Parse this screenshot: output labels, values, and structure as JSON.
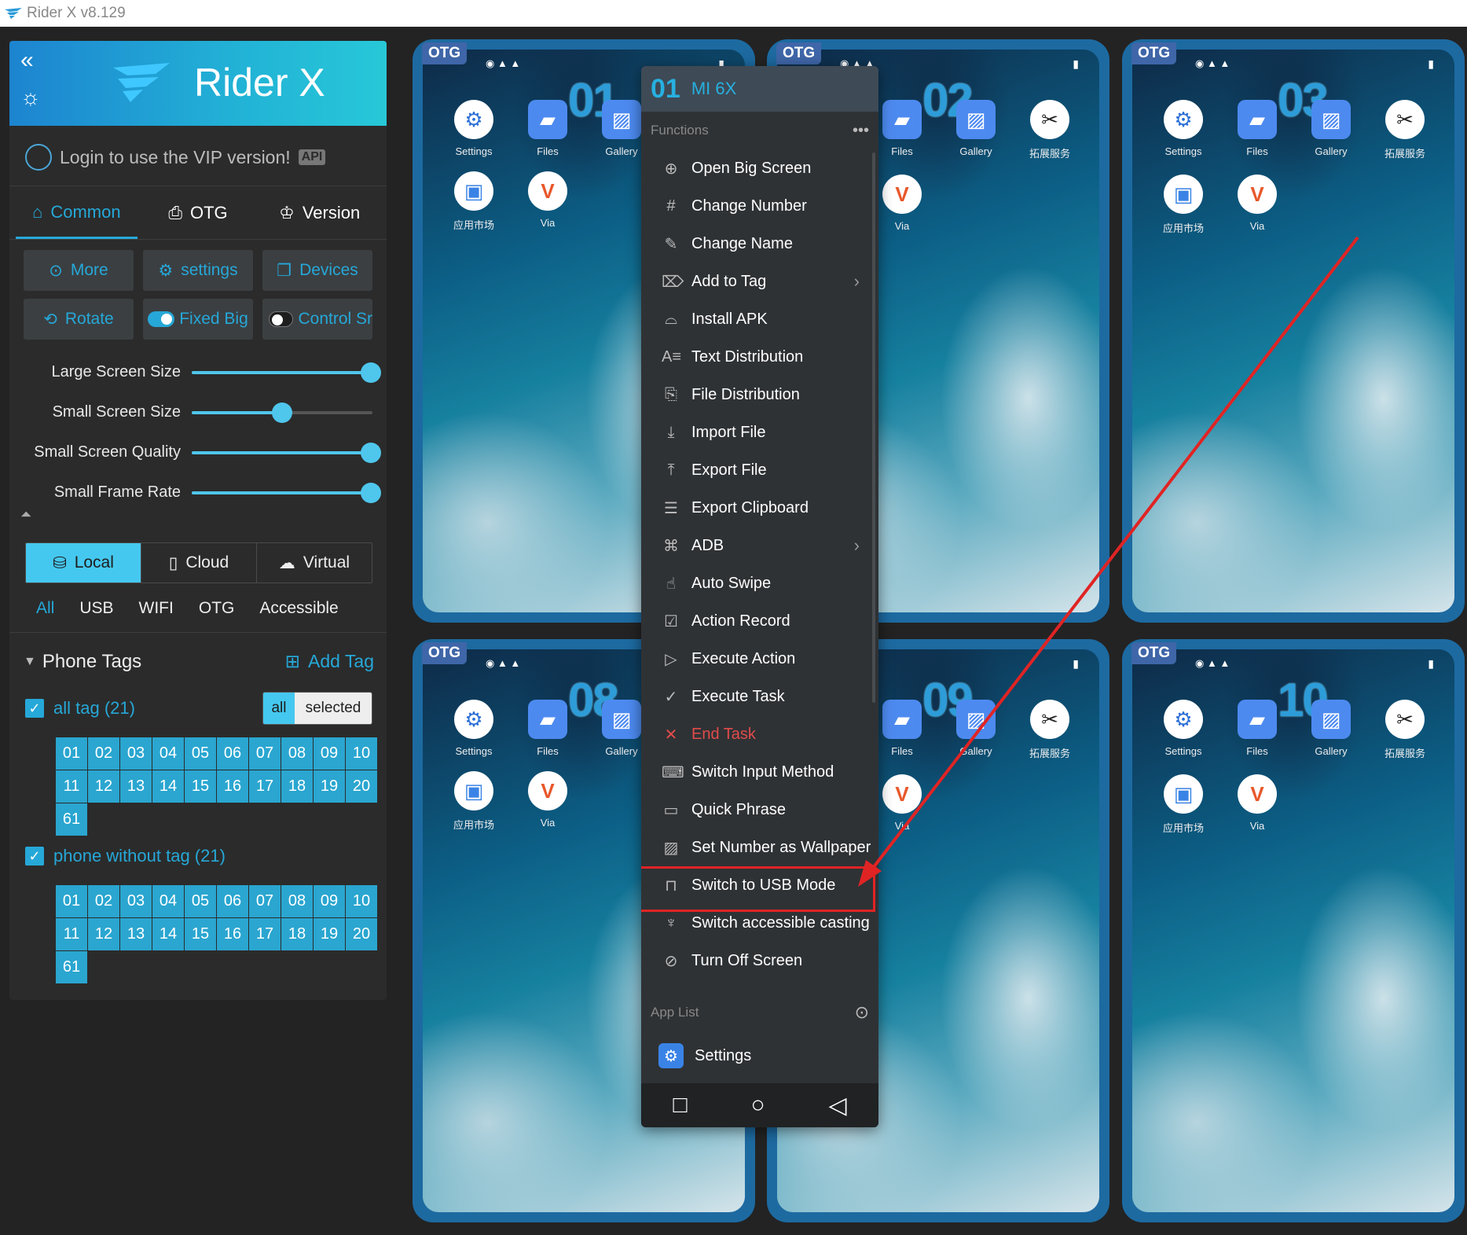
{
  "window": {
    "title": "Rider X v8.129"
  },
  "brand": {
    "name": "Rider X"
  },
  "login": {
    "text": "Login to use the VIP version!",
    "badge": "API"
  },
  "tabs": [
    {
      "label": "Common"
    },
    {
      "label": "OTG"
    },
    {
      "label": "Version"
    }
  ],
  "buttons": {
    "more": "More",
    "settings": "settings",
    "devices": "Devices",
    "rotate": "Rotate",
    "fixed_big": "Fixed Big",
    "control": "Control Sr"
  },
  "sliders": [
    {
      "label": "Large Screen Size",
      "value": 1.0
    },
    {
      "label": "Small Screen Size",
      "value": 0.5
    },
    {
      "label": "Small Screen Quality",
      "value": 1.0
    },
    {
      "label": "Small Frame Rate",
      "value": 1.0
    }
  ],
  "source_tabs": [
    {
      "label": "Local"
    },
    {
      "label": "Cloud"
    },
    {
      "label": "Virtual"
    }
  ],
  "filters": [
    "All",
    "USB",
    "WIFI",
    "OTG",
    "Accessible"
  ],
  "phone_tags": {
    "title": "Phone Tags",
    "add_label": "Add Tag"
  },
  "groups": [
    {
      "label": "all tag (21)",
      "numbers": [
        "01",
        "02",
        "03",
        "04",
        "05",
        "06",
        "07",
        "08",
        "09",
        "10",
        "11",
        "12",
        "13",
        "14",
        "15",
        "16",
        "17",
        "18",
        "19",
        "20",
        "61"
      ]
    },
    {
      "label": "phone without tag (21)",
      "numbers": [
        "01",
        "02",
        "03",
        "04",
        "05",
        "06",
        "07",
        "08",
        "09",
        "10",
        "11",
        "12",
        "13",
        "14",
        "15",
        "16",
        "17",
        "18",
        "19",
        "20",
        "61"
      ]
    }
  ],
  "allsel": {
    "all": "all",
    "selected": "selected"
  },
  "phones": [
    {
      "badge": "OTG",
      "number": "01"
    },
    {
      "badge": "OTG",
      "number": "02"
    },
    {
      "badge": "OTG",
      "number": "03"
    },
    {
      "badge": "OTG",
      "number": "08"
    },
    {
      "badge": "OTG",
      "number": "09"
    },
    {
      "badge": "OTG",
      "number": "10"
    }
  ],
  "apps": {
    "settings": "Settings",
    "files": "Files",
    "gallery": "Gallery",
    "tool": "拓展服务",
    "store": "应用市场",
    "via": "Via"
  },
  "menu": {
    "number": "01",
    "model": "MI 6X",
    "functions_label": "Functions",
    "items": [
      {
        "label": "Open Big Screen",
        "icon": "zoom-in-icon"
      },
      {
        "label": "Change Number",
        "icon": "hash-icon"
      },
      {
        "label": "Change Name",
        "icon": "pencil-icon"
      },
      {
        "label": "Add to Tag",
        "icon": "tag-icon"
      },
      {
        "label": "Install APK",
        "icon": "android-icon"
      },
      {
        "label": "Text Distribution",
        "icon": "text-icon"
      },
      {
        "label": "File Distribution",
        "icon": "file-icon"
      },
      {
        "label": "Import File",
        "icon": "download-icon"
      },
      {
        "label": "Export File",
        "icon": "upload-icon"
      },
      {
        "label": "Export Clipboard",
        "icon": "clipboard-icon"
      },
      {
        "label": "ADB",
        "icon": "command-icon"
      },
      {
        "label": "Auto Swipe",
        "icon": "swipe-icon"
      },
      {
        "label": "Action Record",
        "icon": "record-icon"
      },
      {
        "label": "Execute Action",
        "icon": "play-icon"
      },
      {
        "label": "Execute Task",
        "icon": "task-icon"
      },
      {
        "label": "End Task",
        "icon": "close-icon"
      },
      {
        "label": "Switch Input Method",
        "icon": "keyboard-icon"
      },
      {
        "label": "Quick Phrase",
        "icon": "message-icon"
      },
      {
        "label": "Set Number as Wallpaper",
        "icon": "image-icon"
      },
      {
        "label": "Switch to USB Mode",
        "icon": "usb-icon"
      },
      {
        "label": "Switch accessible casting",
        "icon": "accessibility-icon"
      },
      {
        "label": "Turn Off Screen",
        "icon": "eye-off-icon"
      }
    ],
    "app_list_label": "App List",
    "app_settings": "Settings"
  }
}
